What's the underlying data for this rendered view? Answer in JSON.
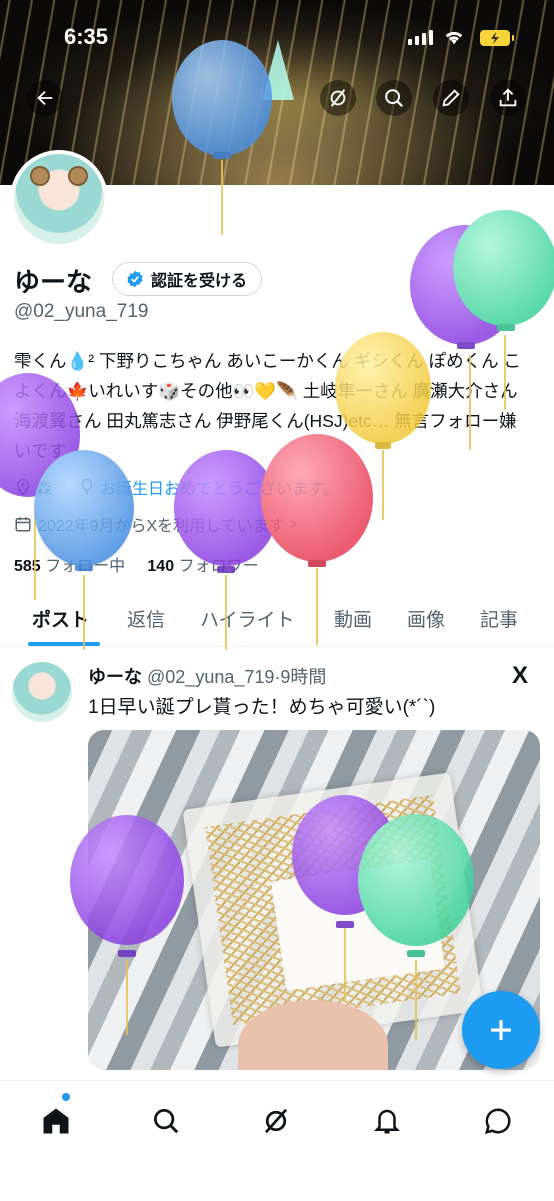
{
  "status": {
    "time": "6:35"
  },
  "profile": {
    "name": "ゆーな",
    "verify_label": "認証を受ける",
    "handle": "@02_yuna_719",
    "bio": "雫くん💧² 下野りこちゃん あいこーかくん ギシくん ぽめくん こよくん🍁いれいす🎲その他👀💛🪶 土岐隼一さん 廣瀬大介さん 海渡翼さん 田丸篤志さん 伊野尾くん(HSJ)etc… 無言フォロー嫌いです",
    "location": "森",
    "birthday_text": "お誕生日おめでとうございます。",
    "joined": "2022年9月からXを利用しています",
    "following_count": "585",
    "following_label": "フォロー中",
    "followers_count": "140",
    "followers_label": "フォロワー"
  },
  "tabs": [
    "ポスト",
    "返信",
    "ハイライト",
    "動画",
    "画像",
    "記事"
  ],
  "tweet": {
    "name": "ゆーな",
    "handle": "@02_yuna_719",
    "sep": "·",
    "time": "9時間",
    "text": "1日早い誕プレ貰った！めちゃ可愛い(*´`)",
    "x_logo": "X"
  },
  "icons": {
    "back": "back-arrow-icon",
    "grok": "grok-icon",
    "search": "search-icon",
    "edit": "pencil-icon",
    "share": "share-icon",
    "fab": "plus-icon"
  },
  "colors": {
    "accent": "#1d9bf0",
    "text": "#0f1419",
    "secondary": "#536471"
  }
}
